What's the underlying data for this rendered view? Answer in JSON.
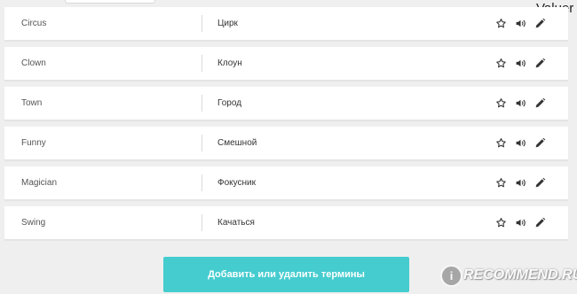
{
  "watermark_top": "Valuer",
  "terms": [
    {
      "term": "Circus",
      "translation": "Цирк"
    },
    {
      "term": "Clown",
      "translation": "Клоун"
    },
    {
      "term": "Town",
      "translation": "Город"
    },
    {
      "term": "Funny",
      "translation": "Смешной"
    },
    {
      "term": "Magician",
      "translation": "Фокусник"
    },
    {
      "term": "Swing",
      "translation": "Качаться"
    }
  ],
  "icons": {
    "favorite": "star-outline-icon",
    "audio": "speaker-icon",
    "edit": "pencil-icon"
  },
  "add_button_label": "Добавить или удалить термины",
  "watermark": "iRECOMMEND.RU",
  "colors": {
    "accent": "#45cccf",
    "background": "#efefef",
    "row": "#ffffff"
  }
}
